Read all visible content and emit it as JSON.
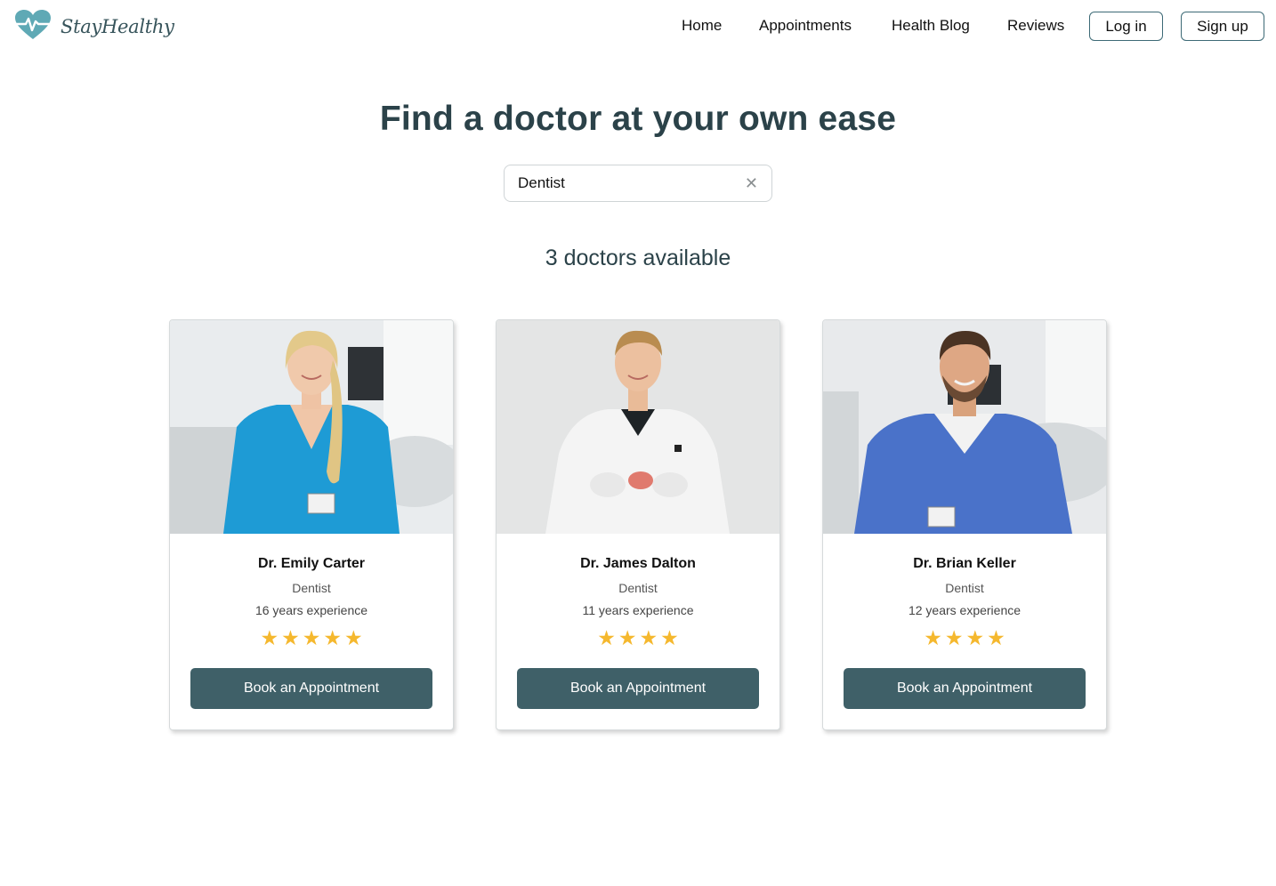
{
  "brand": {
    "name": "StayHealthy",
    "logo_icon": "heart-pulse-icon",
    "logo_color": "#5fa9b5"
  },
  "nav": {
    "links": [
      "Home",
      "Appointments",
      "Health Blog",
      "Reviews"
    ],
    "login_label": "Log in",
    "signup_label": "Sign up"
  },
  "hero": {
    "headline": "Find a doctor at your own ease",
    "search_value": "Dentist",
    "clear_icon": "close-icon",
    "results_count": "3 doctors available"
  },
  "doctors": [
    {
      "name": "Dr. Emily Carter",
      "specialty": "Dentist",
      "experience": "16 years experience",
      "rating": 5,
      "photo": "doctor-photo-woman-teal-scrubs",
      "button_label": "Book an Appointment"
    },
    {
      "name": "Dr. James Dalton",
      "specialty": "Dentist",
      "experience": "11 years experience",
      "rating": 4,
      "photo": "doctor-photo-man-white-coat",
      "button_label": "Book an Appointment"
    },
    {
      "name": "Dr. Brian Keller",
      "specialty": "Dentist",
      "experience": "12 years experience",
      "rating": 4,
      "photo": "doctor-photo-man-blue-scrubs",
      "button_label": "Book an Appointment"
    }
  ],
  "colors": {
    "accent": "#3f6068",
    "star": "#f5b82e",
    "heading": "#2b4249"
  }
}
